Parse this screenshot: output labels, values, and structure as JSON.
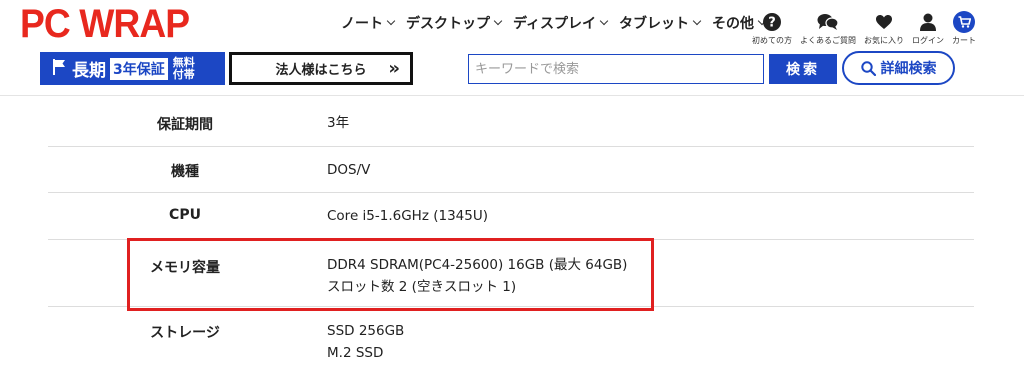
{
  "logo": "PC WRAP",
  "nav": [
    {
      "label": "ノート"
    },
    {
      "label": "デスクトップ"
    },
    {
      "label": "ディスプレイ"
    },
    {
      "label": "タブレット"
    },
    {
      "label": "その他"
    }
  ],
  "header_icons": [
    {
      "icon": "help-icon",
      "label": "初めての方"
    },
    {
      "icon": "faq-icon",
      "label": "よくあるご質問"
    },
    {
      "icon": "heart-icon",
      "label": "お気に入り"
    },
    {
      "icon": "user-icon",
      "label": "ログイン"
    },
    {
      "icon": "cart-icon",
      "label": "カート"
    }
  ],
  "warranty": {
    "prefix": "長期",
    "box": "3年保証",
    "free": "無料付帯"
  },
  "corp_button": {
    "label": "法人様はこちら",
    "arrow": "»"
  },
  "search": {
    "placeholder": "キーワードで検索",
    "value": "",
    "button": "検索"
  },
  "advanced_search": {
    "label": "詳細検索"
  },
  "colors": {
    "brand_red": "#e8281e",
    "accent_blue": "#1c47c4",
    "highlight_red": "#e02020"
  },
  "specs": [
    {
      "label": "保証期間",
      "value": [
        "3年"
      ]
    },
    {
      "label": "機種",
      "value": [
        "DOS/V"
      ]
    },
    {
      "label": "CPU",
      "value": [
        "Core i5-1.6GHz (1345U)"
      ]
    },
    {
      "label": "メモリ容量",
      "value": [
        "DDR4 SDRAM(PC4-25600) 16GB (最大 64GB)",
        "スロット数 2 (空きスロット 1)"
      ],
      "highlighted": true
    },
    {
      "label": "ストレージ",
      "value": [
        "SSD 256GB",
        "M.2 SSD"
      ]
    }
  ]
}
